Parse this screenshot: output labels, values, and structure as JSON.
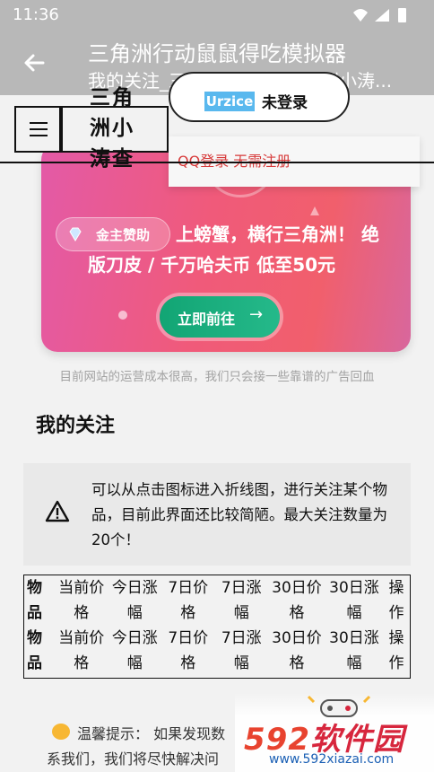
{
  "status_bar": {
    "time": "11:36"
  },
  "app_bar": {
    "title": "三角洲行动鼠鼠得吃模拟器",
    "subtitle": "我的关注_三角洲经济学_三角洲小涛..."
  },
  "header": {
    "site_logo": "三角洲小涛查",
    "login_logo": "Urzice",
    "login_status": "未登录",
    "qq_login": "QQ登录 无需注册"
  },
  "ad": {
    "badge": "金主赞助",
    "headline_line1": "上螃蟹，横行三角洲！ 绝",
    "headline_line2": "版刀皮 / 千万哈夫币 低至50元",
    "cta": "立即前往",
    "cta_arrow": "→",
    "note": "目前网站的运营成本很高，我们只会接一些靠谱的广告回血"
  },
  "follows": {
    "title": "我的关注",
    "notice": "可以从点击图标进入折线图，进行关注某个物品，目前此界面还比较简陋。最大关注数量为20个！",
    "columns": [
      "物品",
      "当前价格",
      "今日涨幅",
      "7日价格",
      "7日涨幅",
      "30日价格",
      "30日涨幅",
      "操作"
    ]
  },
  "tip": {
    "line1": "温馨提示：  如果发现数",
    "line2": "系我们，我们将尽快解决问"
  },
  "watermark": {
    "num": "592",
    "text": "软件园",
    "url": "www.592xiazai.com"
  },
  "colors": {
    "appbar": "#b8b8b8",
    "ad_start": "#e35aa7",
    "ad_end": "#f15f6c",
    "cta": "#12a574",
    "qq_red": "#d73a3a"
  }
}
